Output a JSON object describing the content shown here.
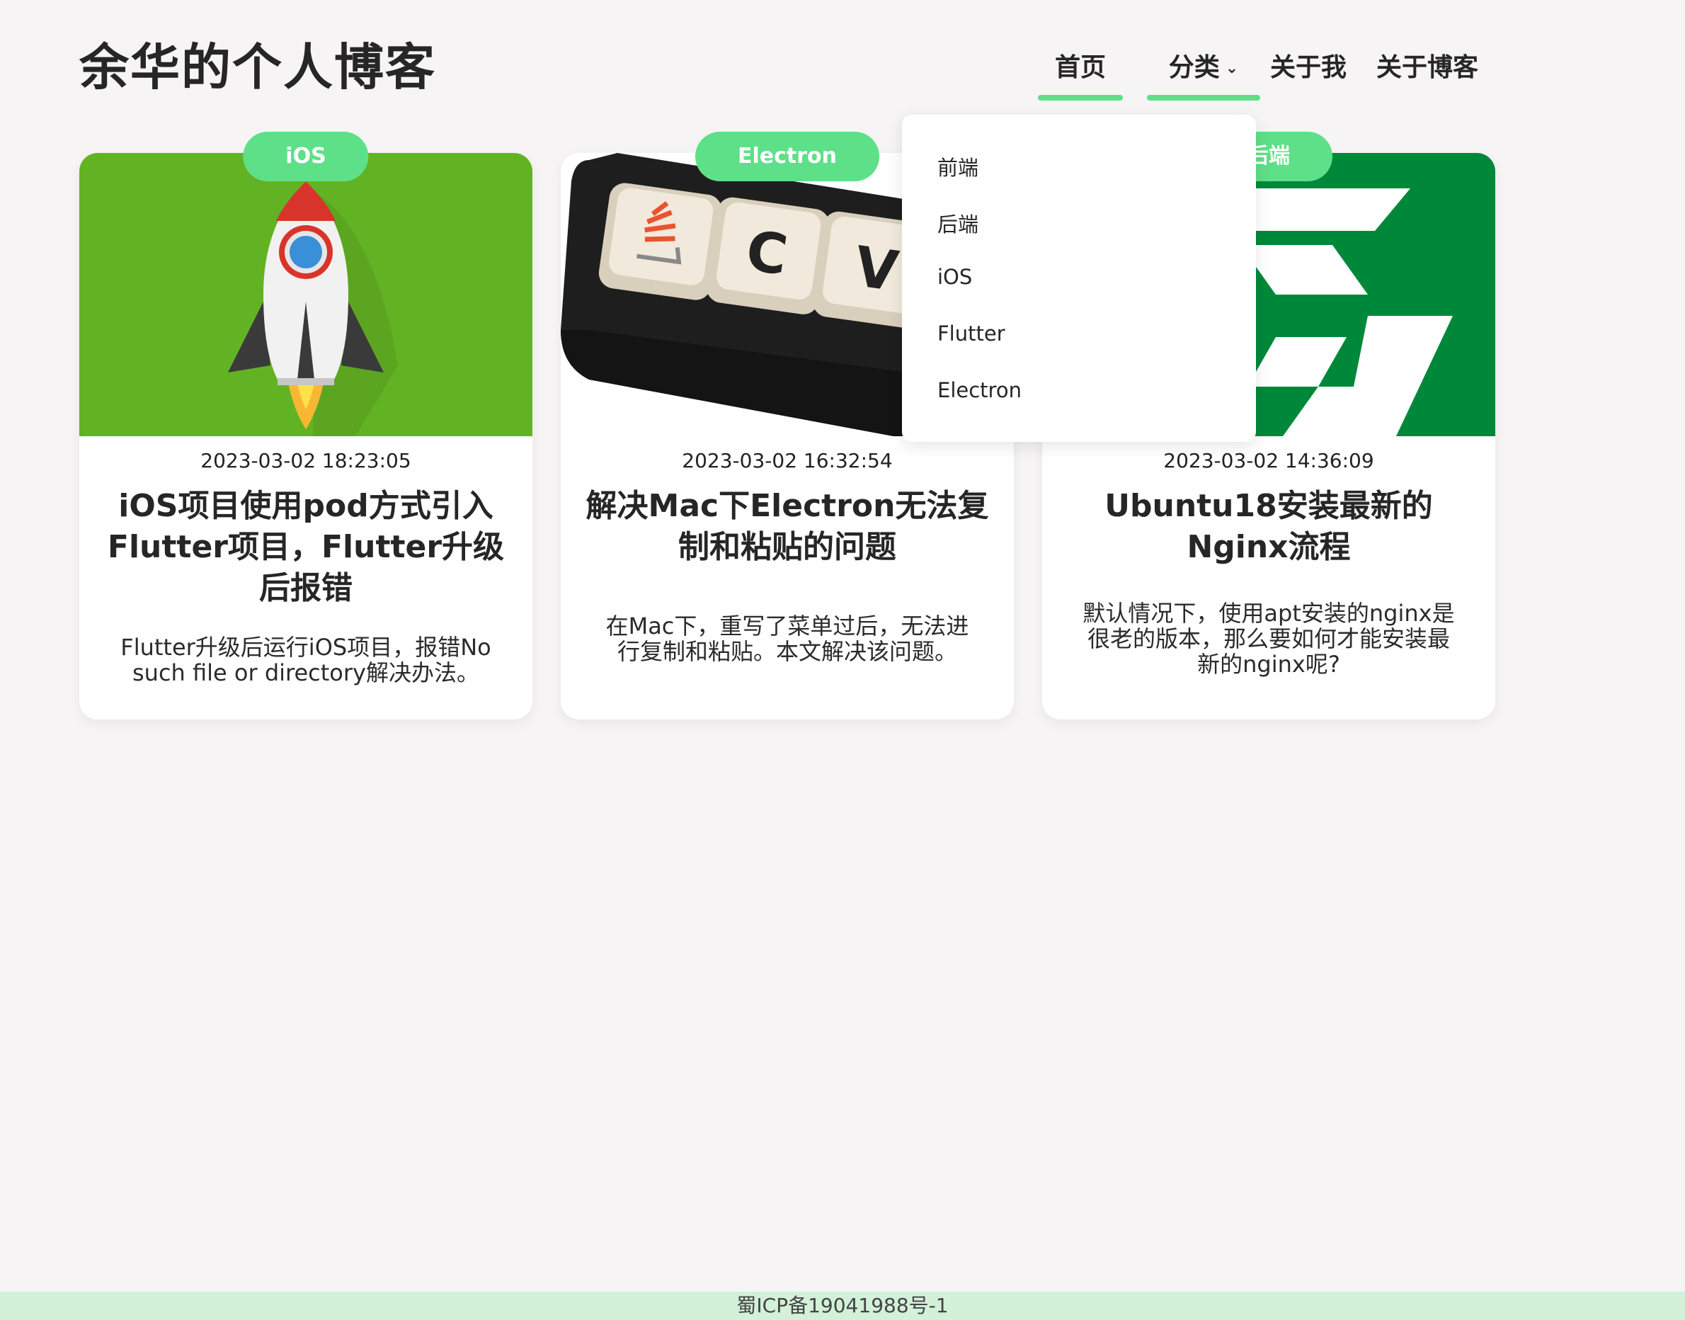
{
  "site": {
    "title": "余华的个人博客"
  },
  "nav": {
    "home": "首页",
    "category": "分类",
    "about_me": "关于我",
    "about_blog": "关于博客",
    "accent_color": "#5ee088"
  },
  "dropdown": {
    "items": [
      "前端",
      "后端",
      "iOS",
      "Flutter",
      "Electron"
    ]
  },
  "cards": [
    {
      "tag": "iOS",
      "date": "2023-03-02 18:23:05",
      "title": "iOS项目使用pod方式引入Flutter项目，Flutter升级后报错",
      "summary": "Flutter升级后运行iOS项目，报错No such file or directory解决办法。",
      "image": "rocket-illustration"
    },
    {
      "tag": "Electron",
      "date": "2023-03-02 16:32:54",
      "title": "解决Mac下Electron无法复制和粘贴的问题",
      "summary": "在Mac下，重写了菜单过后，无法进行复制和粘贴。本文解决该问题。",
      "image": "keyboard-keycaps-photo"
    },
    {
      "tag": "后端",
      "date": "2023-03-02 14:36:09",
      "title": "Ubuntu18安装最新的Nginx流程",
      "summary": "默认情况下，使用apt安装的nginx是很老的版本，那么要如何才能安装最新的nginx呢?",
      "image": "nginx-logo"
    }
  ],
  "footer": {
    "icp": "蜀ICP备19041988号-1"
  }
}
